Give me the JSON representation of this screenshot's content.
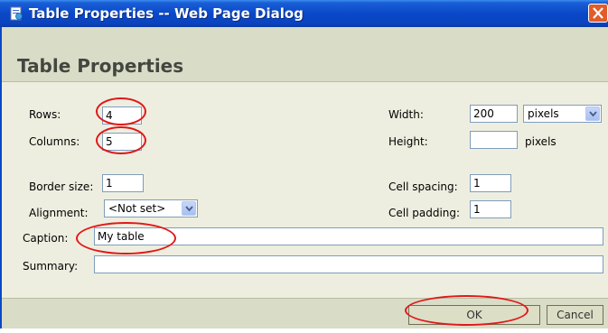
{
  "window": {
    "title": "Table Properties -- Web Page Dialog"
  },
  "header": {
    "title": "Table Properties"
  },
  "form": {
    "rows": {
      "label": "Rows:",
      "value": "4"
    },
    "columns": {
      "label": "Columns:",
      "value": "5"
    },
    "width": {
      "label": "Width:",
      "value": "200",
      "unit_selected": "pixels"
    },
    "height": {
      "label": "Height:",
      "value": "",
      "unit": "pixels"
    },
    "border_size": {
      "label": "Border size:",
      "value": "1"
    },
    "alignment": {
      "label": "Alignment:",
      "selected": "<Not set>"
    },
    "cell_spacing": {
      "label": "Cell spacing:",
      "value": "1"
    },
    "cell_padding": {
      "label": "Cell padding:",
      "value": "1"
    },
    "caption": {
      "label": "Caption:",
      "value": "My table"
    },
    "summary": {
      "label": "Summary:",
      "value": ""
    }
  },
  "buttons": {
    "ok": "OK",
    "cancel": "Cancel"
  },
  "icons": {
    "title_icon": "page-icon",
    "close": "close-icon",
    "dropdown": "chevron-down-icon"
  },
  "colors": {
    "titlebar": "#0a48c8",
    "close": "#e25b2a",
    "annotation": "#e0181a",
    "panel": "#eeeee0",
    "header": "#d9dcc6"
  }
}
